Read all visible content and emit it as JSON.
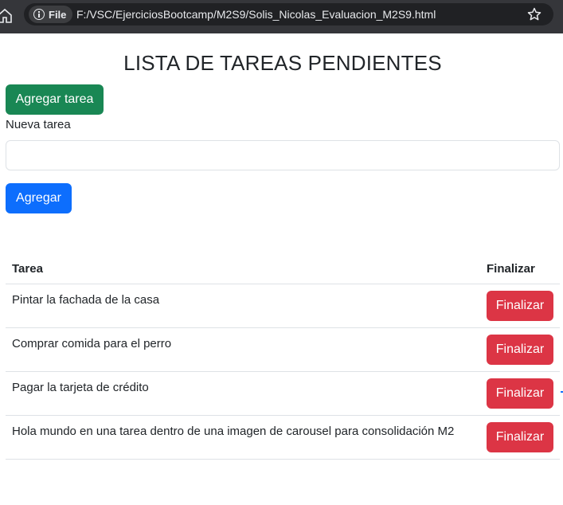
{
  "browser": {
    "file_label": "File",
    "url": "F:/VSC/EjerciciosBootcamp/M2S9/Solis_Nicolas_Evaluacion_M2S9.html"
  },
  "page": {
    "title": "LISTA DE TAREAS PENDIENTES",
    "add_task_button": "Agregar tarea",
    "new_task_label": "Nueva tarea",
    "new_task_value": "",
    "add_button": "Agregar"
  },
  "table": {
    "headers": {
      "task": "Tarea",
      "finish": "Finalizar"
    },
    "rows": [
      {
        "task": "Pintar la fachada de la casa",
        "button": "Finalizar"
      },
      {
        "task": "Comprar comida para el perro",
        "button": "Finalizar"
      },
      {
        "task": "Pagar la tarjeta de crédito",
        "button": "Finalizar"
      },
      {
        "task": "Hola mundo en una tarea dentro de una imagen de carousel para consolidación M2",
        "button": "Finalizar"
      }
    ]
  },
  "colors": {
    "success": "#198754",
    "primary": "#0d6efd",
    "danger": "#dc3545",
    "browser_bar": "#35363a"
  }
}
